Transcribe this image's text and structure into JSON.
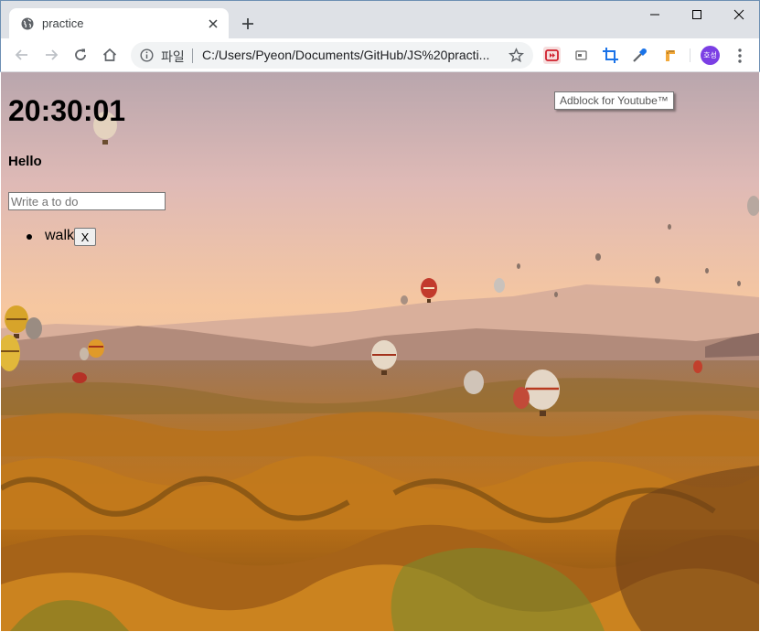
{
  "browser": {
    "tab_title": "practice",
    "file_label": "파일",
    "url": "C:/Users/Pyeon/Documents/GitHub/JS%20practi...",
    "avatar_text": "호성",
    "tooltip": "Adblock for Youtube™",
    "icons": {
      "favicon": "globe-icon",
      "back": "arrow-left-icon",
      "forward": "arrow-right-icon",
      "reload": "reload-icon",
      "home": "home-icon",
      "info": "info-icon",
      "bookmark": "star-icon",
      "menu": "kebab-menu-icon"
    },
    "accent": "#7b3fe4"
  },
  "page": {
    "clock": "20:30:01",
    "greeting": "Hello",
    "todo_placeholder": "Write a to do",
    "todos": [
      {
        "text": "walk",
        "delete_label": "X"
      }
    ],
    "background": "hot-air-balloons-landscape"
  }
}
